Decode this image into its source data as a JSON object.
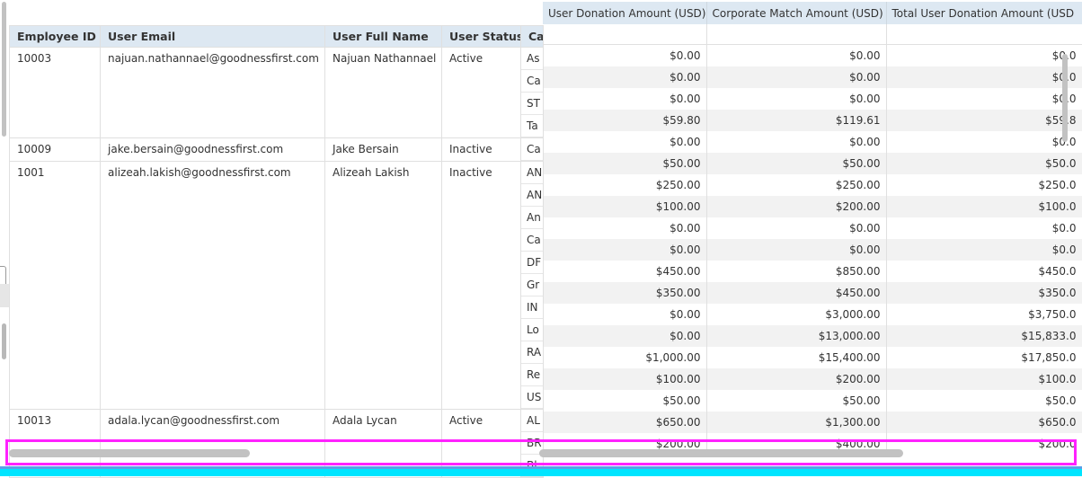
{
  "left_headers": [
    "Employee ID",
    "User Email",
    "User Full Name",
    "User Status",
    "Ca"
  ],
  "users": [
    {
      "id": "10003",
      "email": "najuan.nathannael@goodnessfirst.com",
      "name": "Najuan Nathannael",
      "status": "Active",
      "causes": [
        "As",
        "Ca",
        "ST",
        "Ta"
      ]
    },
    {
      "id": "10009",
      "email": "jake.bersain@goodnessfirst.com",
      "name": "Jake Bersain",
      "status": "Inactive",
      "causes": [
        "Ca"
      ]
    },
    {
      "id": "1001",
      "email": "alizeah.lakish@goodnessfirst.com",
      "name": "Alizeah Lakish",
      "status": "Inactive",
      "causes": [
        "AN",
        "AN",
        "An",
        "Ca",
        "DF",
        "Gr",
        "IN",
        "Lo",
        "RA",
        "Re",
        "US"
      ]
    },
    {
      "id": "10013",
      "email": "adala.lycan@goodnessfirst.com",
      "name": "Adala Lycan",
      "status": "Active",
      "causes": [
        "AL",
        "BR",
        "Bl"
      ]
    }
  ],
  "right_headers": [
    "User Donation Amount (USD)",
    "Corporate Match Amount (USD)",
    "Total User Donation Amount (USD"
  ],
  "amount_rows": [
    [
      "$0.00",
      "$0.00",
      "$0.0"
    ],
    [
      "$0.00",
      "$0.00",
      "$0.0"
    ],
    [
      "$0.00",
      "$0.00",
      "$0.0"
    ],
    [
      "$59.80",
      "$119.61",
      "$59.8"
    ],
    [
      "$0.00",
      "$0.00",
      "$0.0"
    ],
    [
      "$50.00",
      "$50.00",
      "$50.0"
    ],
    [
      "$250.00",
      "$250.00",
      "$250.0"
    ],
    [
      "$100.00",
      "$200.00",
      "$100.0"
    ],
    [
      "$0.00",
      "$0.00",
      "$0.0"
    ],
    [
      "$0.00",
      "$0.00",
      "$0.0"
    ],
    [
      "$450.00",
      "$850.00",
      "$450.0"
    ],
    [
      "$350.00",
      "$450.00",
      "$350.0"
    ],
    [
      "$0.00",
      "$3,000.00",
      "$3,750.0"
    ],
    [
      "$0.00",
      "$13,000.00",
      "$15,833.0"
    ],
    [
      "$1,000.00",
      "$15,400.00",
      "$17,850.0"
    ],
    [
      "$100.00",
      "$200.00",
      "$100.0"
    ],
    [
      "$50.00",
      "$50.00",
      "$50.0"
    ],
    [
      "$650.00",
      "$1,300.00",
      "$650.0"
    ],
    [
      "$200.00",
      "$400.00",
      "$200.0"
    ]
  ]
}
